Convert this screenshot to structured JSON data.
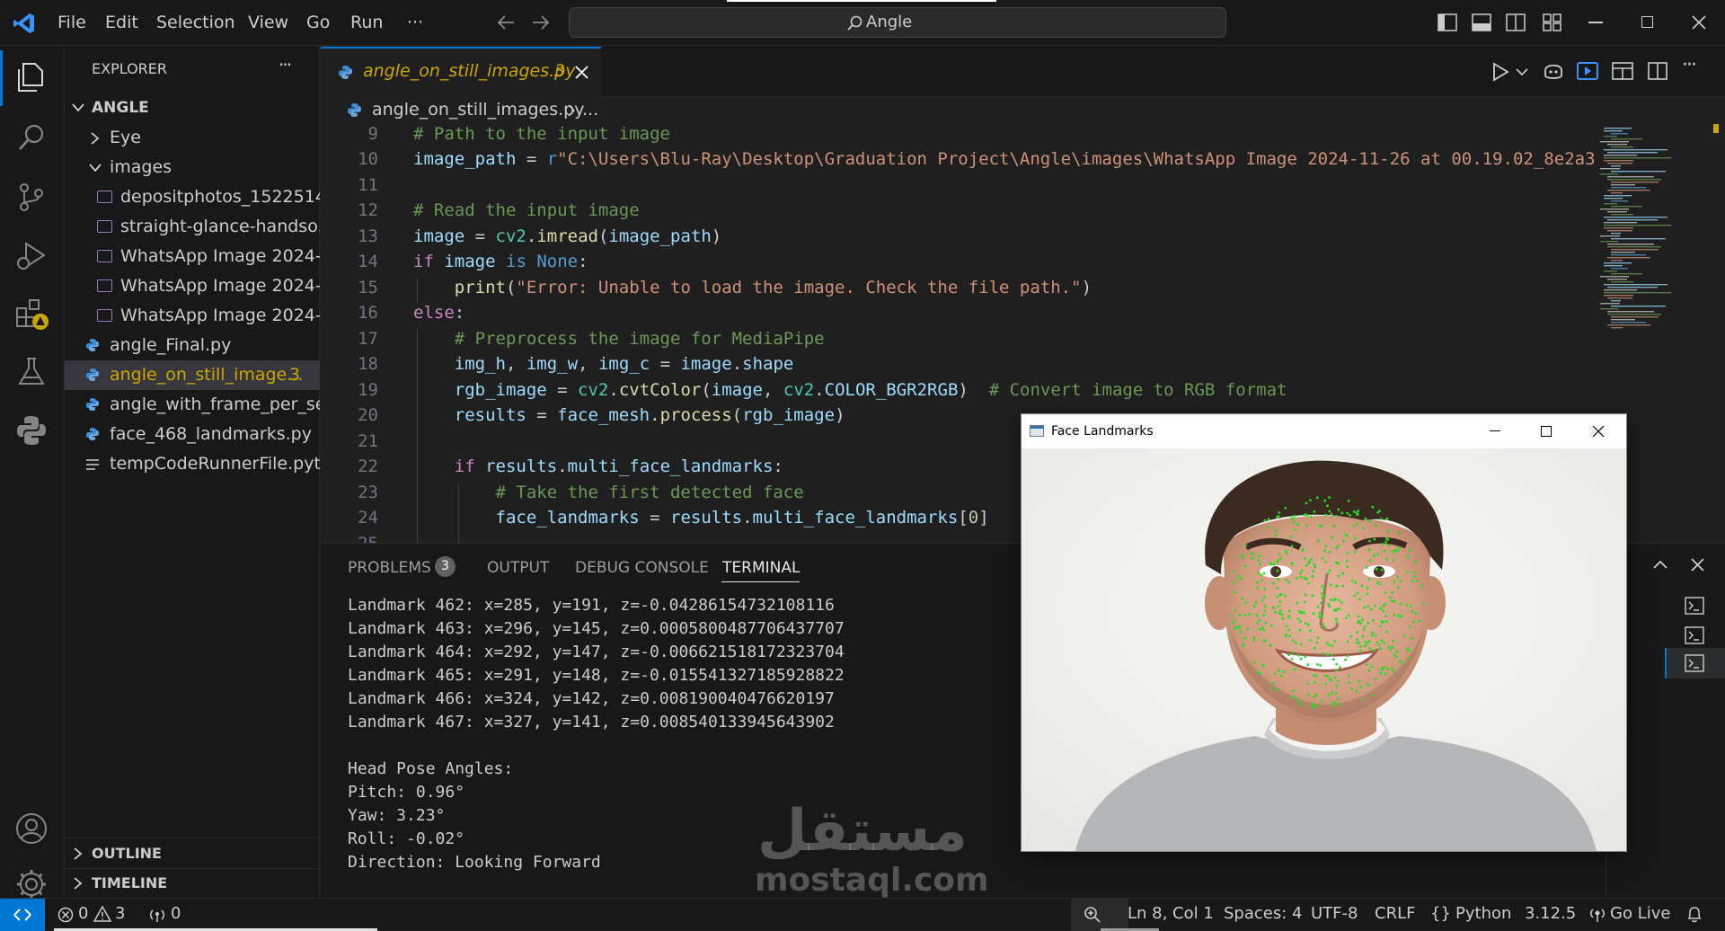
{
  "window": {
    "search_text": "Angle",
    "menus": [
      "File",
      "Edit",
      "Selection",
      "View",
      "Go",
      "Run",
      "···"
    ]
  },
  "sidebar": {
    "title": "EXPLORER",
    "more": "···",
    "root": "ANGLE",
    "items": [
      {
        "label": "Eye",
        "type": "folder-collapsed"
      },
      {
        "label": "images",
        "type": "folder-expanded"
      },
      {
        "label": "depositphotos_1522514...",
        "type": "image"
      },
      {
        "label": "straight-glance-handso...",
        "type": "image"
      },
      {
        "label": "WhatsApp Image 2024-...",
        "type": "image"
      },
      {
        "label": "WhatsApp Image 2024-...",
        "type": "image"
      },
      {
        "label": "WhatsApp Image 2024-...",
        "type": "image"
      },
      {
        "label": "angle_Final.py",
        "type": "python"
      },
      {
        "label": "angle_on_still_image...",
        "type": "python",
        "badge": "3",
        "selected": true
      },
      {
        "label": "angle_with_frame_per_se...",
        "type": "python"
      },
      {
        "label": "face_468_landmarks.py",
        "type": "python"
      },
      {
        "label": "tempCodeRunnerFile.pyt...",
        "type": "text"
      }
    ],
    "outline": "OUTLINE",
    "timeline": "TIMELINE"
  },
  "editor": {
    "tab_label": "angle_on_still_images.py",
    "tab_badge": "3",
    "breadcrumb_file": "angle_on_still_images.py",
    "breadcrumb_more": "...",
    "line_numbers": [
      "9",
      "10",
      "11",
      "12",
      "13",
      "14",
      "15",
      "16",
      "17",
      "18",
      "19",
      "20",
      "21",
      "22",
      "23",
      "24",
      "25"
    ]
  },
  "panel": {
    "tabs": [
      "PROBLEMS",
      "OUTPUT",
      "DEBUG CONSOLE",
      "TERMINAL"
    ],
    "problems_count": "3",
    "terminal_lines": [
      "Landmark 462: x=285, y=191, z=-0.04286154732108116",
      "Landmark 463: x=296, y=145, z=0.0005800487706437707",
      "Landmark 464: x=292, y=147, z=-0.006621518172323704",
      "Landmark 465: x=291, y=148, z=-0.015541327185928822",
      "Landmark 466: x=324, y=142, z=0.008190040476620197",
      "Landmark 467: x=327, y=141, z=0.008540133945643902",
      "",
      "Head Pose Angles:",
      "Pitch: 0.96°",
      "Yaw: 3.23°",
      "Roll: -0.02°",
      "Direction: Looking Forward"
    ]
  },
  "statusbar": {
    "errors": "0",
    "warnings": "3",
    "ports": "0",
    "position": "Ln 8, Col 1",
    "spaces": "Spaces: 4",
    "encoding": "UTF-8",
    "eol": "CRLF",
    "language": "Python",
    "version": "3.12.5",
    "golive": "Go Live"
  },
  "face_window": {
    "title": "Face Landmarks"
  },
  "watermark": {
    "arabic": "مستقل",
    "latin": "mostaql.com"
  },
  "colors": {
    "accent": "#0078d4",
    "landmark": "#22dd22",
    "comment": "#6a9955",
    "keyword": "#569cd6",
    "string": "#ce9178"
  }
}
